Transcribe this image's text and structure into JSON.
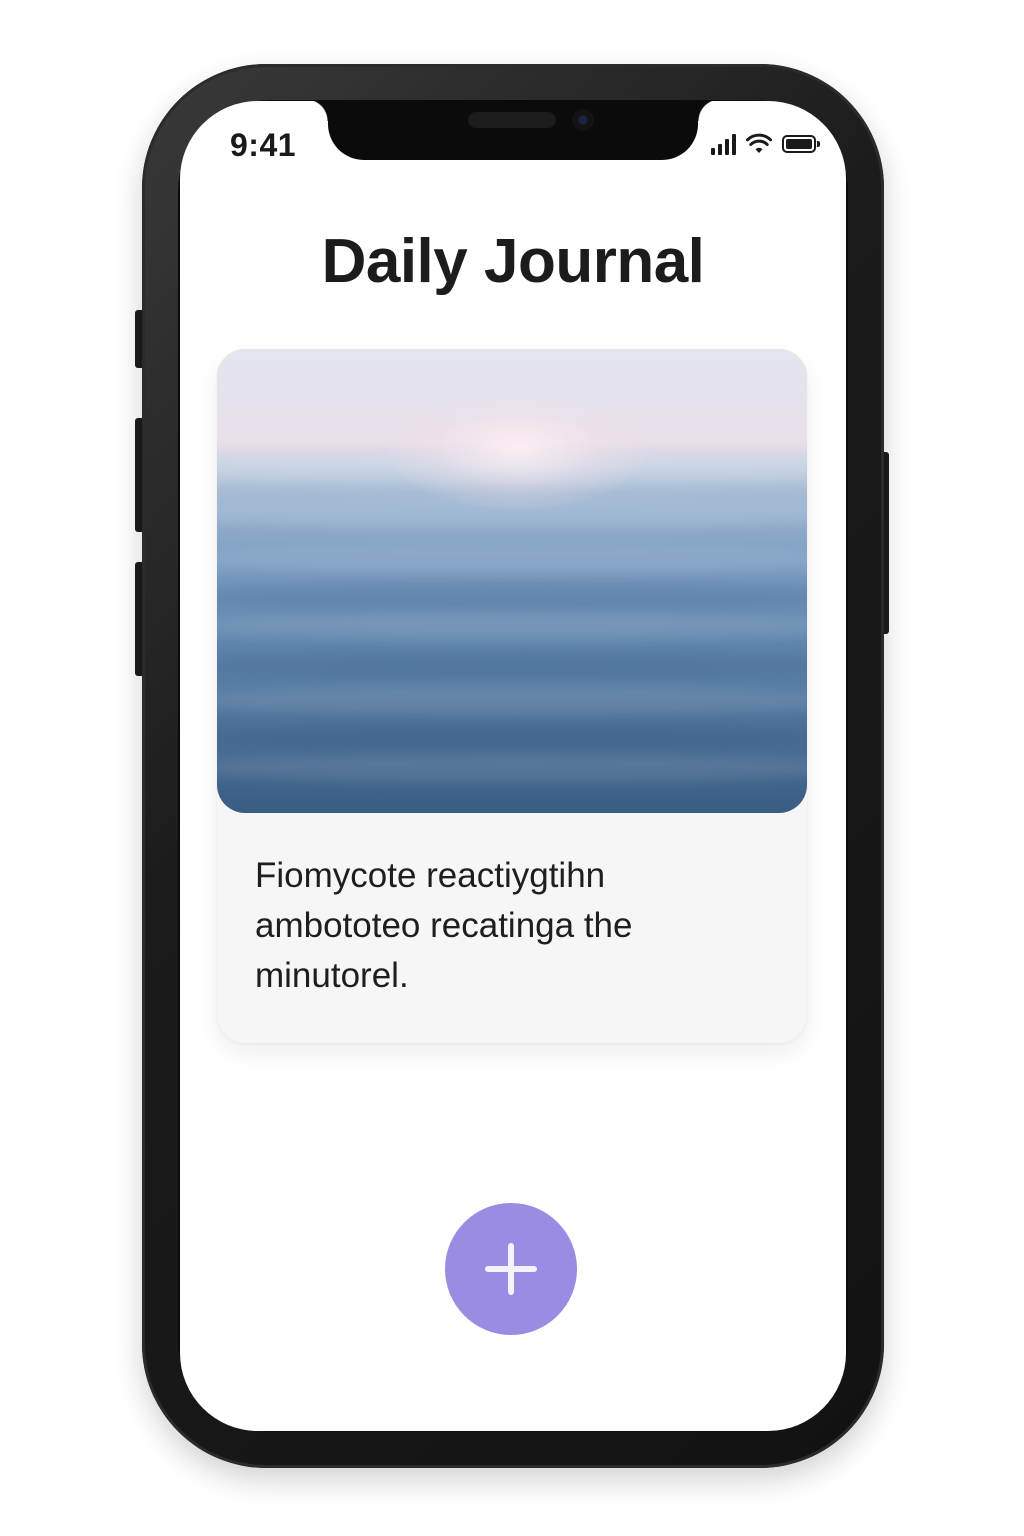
{
  "status_bar": {
    "time": "9:41",
    "signal_icon": "cellular-signal-icon",
    "wifi_icon": "wifi-icon",
    "battery_icon": "battery-full-icon"
  },
  "header": {
    "title": "Daily Journal"
  },
  "entry_card": {
    "image_description_icon": "ocean-photo",
    "text": "Fiomycote reactiygtihn ambototeo recatinga the minutorel."
  },
  "fab": {
    "icon": "plus-icon",
    "color": "#9a8be3"
  },
  "colors": {
    "title": "#1c1c1c",
    "card_background": "#f6f6f7",
    "device_frame": "#121212"
  }
}
